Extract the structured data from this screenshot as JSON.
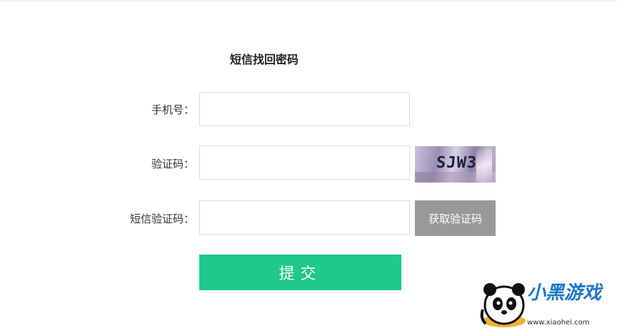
{
  "form": {
    "title": "短信找回密码",
    "phone_label": "手机号：",
    "captcha_label": "验证码：",
    "sms_label": "短信验证码：",
    "phone_value": "",
    "captcha_value": "",
    "sms_value": "",
    "captcha_image_text": "SJW3",
    "sms_button": "获取验证码",
    "submit_button": "提交"
  },
  "watermark": {
    "brand": "小黑游戏",
    "url": "www.xiaohei.com"
  },
  "colors": {
    "submit": "#1ec98b",
    "sms_button": "#999999",
    "border": "#dcdcdc"
  }
}
